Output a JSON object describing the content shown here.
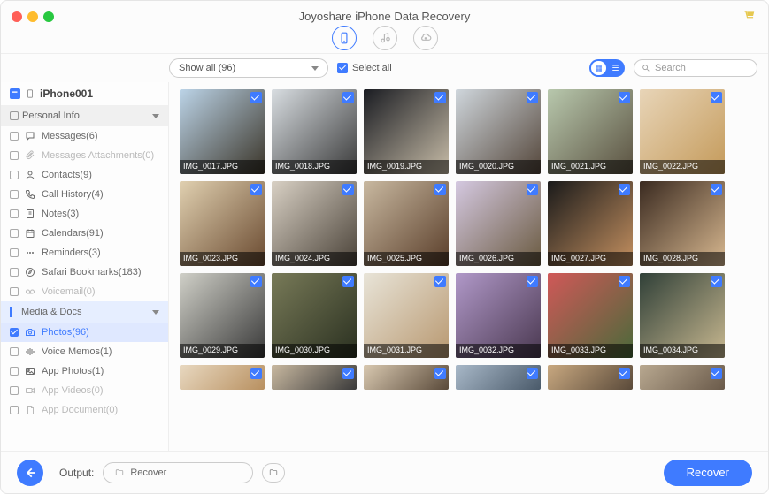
{
  "title": "Joyoshare iPhone Data Recovery",
  "device": {
    "name": "iPhone001"
  },
  "toolbar": {
    "filter": "Show all (96)",
    "select_all": "Select all",
    "search_placeholder": "Search"
  },
  "sidebar": {
    "categories": [
      {
        "name": "Personal Info"
      },
      {
        "name": "Media & Docs"
      }
    ],
    "personal": [
      {
        "label": "Messages(6)",
        "disabled": false,
        "icon": "chat"
      },
      {
        "label": "Messages Attachments(0)",
        "disabled": true,
        "icon": "attach"
      },
      {
        "label": "Contacts(9)",
        "disabled": false,
        "icon": "user"
      },
      {
        "label": "Call History(4)",
        "disabled": false,
        "icon": "phone"
      },
      {
        "label": "Notes(3)",
        "disabled": false,
        "icon": "note"
      },
      {
        "label": "Calendars(91)",
        "disabled": false,
        "icon": "cal"
      },
      {
        "label": "Reminders(3)",
        "disabled": false,
        "icon": "dots"
      },
      {
        "label": "Safari Bookmarks(183)",
        "disabled": false,
        "icon": "compass"
      },
      {
        "label": "Voicemail(0)",
        "disabled": true,
        "icon": "voicemail"
      }
    ],
    "media": [
      {
        "label": "Photos(96)",
        "disabled": false,
        "selected": true,
        "icon": "camera"
      },
      {
        "label": "Voice Memos(1)",
        "disabled": false,
        "icon": "wave"
      },
      {
        "label": "App Photos(1)",
        "disabled": false,
        "icon": "image"
      },
      {
        "label": "App Videos(0)",
        "disabled": true,
        "icon": "video"
      },
      {
        "label": "App Document(0)",
        "disabled": true,
        "icon": "doc"
      }
    ]
  },
  "photos": [
    {
      "name": "IMG_0017.JPG",
      "c1": "#bcd4e8",
      "c2": "#3a3428"
    },
    {
      "name": "IMG_0018.JPG",
      "c1": "#d8dde1",
      "c2": "#3a3a3a"
    },
    {
      "name": "IMG_0019.JPG",
      "c1": "#1a1c22",
      "c2": "#c8bda8"
    },
    {
      "name": "IMG_0020.JPG",
      "c1": "#cfd6dc",
      "c2": "#54463a"
    },
    {
      "name": "IMG_0021.JPG",
      "c1": "#b8c8ad",
      "c2": "#5a5140"
    },
    {
      "name": "IMG_0022.JPG",
      "c1": "#e8d5b8",
      "c2": "#c49a5a"
    },
    {
      "name": "IMG_0023.JPG",
      "c1": "#e0d0b0",
      "c2": "#6a4a30"
    },
    {
      "name": "IMG_0024.JPG",
      "c1": "#d8d0c4",
      "c2": "#4a4238"
    },
    {
      "name": "IMG_0025.JPG",
      "c1": "#c8b8a0",
      "c2": "#5a3e2a"
    },
    {
      "name": "IMG_0026.JPG",
      "c1": "#d4c8e0",
      "c2": "#6a5a40"
    },
    {
      "name": "IMG_0027.JPG",
      "c1": "#1a1a1a",
      "c2": "#c49060"
    },
    {
      "name": "IMG_0028.JPG",
      "c1": "#3a2a20",
      "c2": "#d8b890"
    },
    {
      "name": "IMG_0029.JPG",
      "c1": "#d0d0c8",
      "c2": "#383838"
    },
    {
      "name": "IMG_0030.JPG",
      "c1": "#787a58",
      "c2": "#2a3020"
    },
    {
      "name": "IMG_0031.JPG",
      "c1": "#e8e4d8",
      "c2": "#b89870"
    },
    {
      "name": "IMG_0032.JPG",
      "c1": "#b098c8",
      "c2": "#4a3850"
    },
    {
      "name": "IMG_0033.JPG",
      "c1": "#d05858",
      "c2": "#4a6a3a"
    },
    {
      "name": "IMG_0034.JPG",
      "c1": "#304038",
      "c2": "#c8b890"
    },
    {
      "name": "",
      "c1": "#e8d8c0",
      "c2": "#b89060"
    },
    {
      "name": "",
      "c1": "#c8b8a0",
      "c2": "#3a3a3a"
    },
    {
      "name": "",
      "c1": "#d8c8b0",
      "c2": "#5a4a3a"
    },
    {
      "name": "",
      "c1": "#a8b8c8",
      "c2": "#4a5a6a"
    },
    {
      "name": "",
      "c1": "#c8a880",
      "c2": "#5a4a3a"
    },
    {
      "name": "",
      "c1": "#b8a890",
      "c2": "#6a5a4a"
    }
  ],
  "footer": {
    "output_label": "Output:",
    "output_path": "Recover",
    "recover_button": "Recover"
  }
}
